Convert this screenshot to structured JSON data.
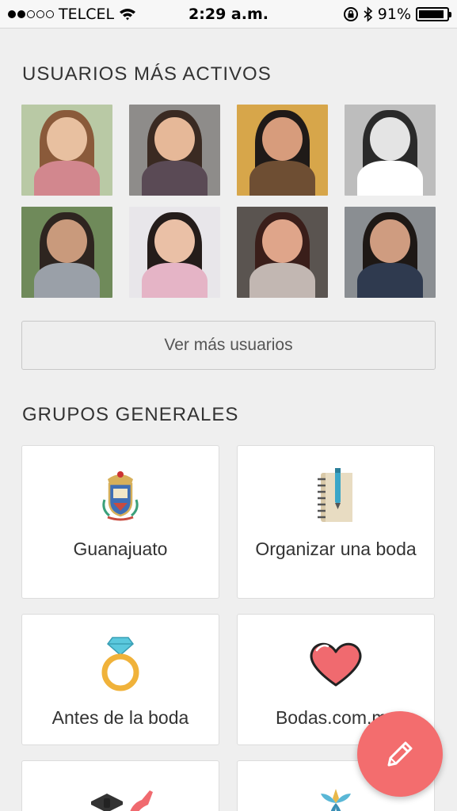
{
  "status_bar": {
    "carrier": "TELCEL",
    "time": "2:29 a.m.",
    "battery": "91%",
    "battery_level": 0.91,
    "signal_bars_filled": 2,
    "signal_bars_total": 5
  },
  "active_users": {
    "title": "USUARIOS MÁS ACTIVOS",
    "more_button": "Ver más usuarios",
    "avatars": [
      {
        "bg": "#b9c9a5",
        "hair": "#8a5a3a",
        "skin": "#e8c0a0",
        "body": "#d2878e"
      },
      {
        "bg": "#8e8c8a",
        "hair": "#3a2a22",
        "skin": "#e6b898",
        "body": "#5a4a55"
      },
      {
        "bg": "#d7a64a",
        "hair": "#1f1a18",
        "skin": "#d79c7c",
        "body": "#6e4e33"
      },
      {
        "bg": "#bdbdbd",
        "hair": "#2a2a2a",
        "skin": "#e4e4e4",
        "body": "#ffffff"
      },
      {
        "bg": "#6f8a5a",
        "hair": "#2e2520",
        "skin": "#c99a7c",
        "body": "#9aa0a8"
      },
      {
        "bg": "#e8e6ea",
        "hair": "#241c1a",
        "skin": "#eac0a6",
        "body": "#e5b4c6"
      },
      {
        "bg": "#5a5450",
        "hair": "#3a1e1a",
        "skin": "#dfa58a",
        "body": "#c2b7b2"
      },
      {
        "bg": "#8a8e92",
        "hair": "#1e1815",
        "skin": "#cf9c80",
        "body": "#2f3a4f"
      }
    ]
  },
  "general_groups": {
    "title": "GRUPOS GENERALES",
    "cards": [
      {
        "label": "Guanajuato",
        "icon": "coat-of-arms-icon"
      },
      {
        "label": "Organizar una boda",
        "icon": "notebook-icon"
      },
      {
        "label": "Antes de la boda",
        "icon": "ring-icon"
      },
      {
        "label": "Bodas.com.mx",
        "icon": "heart-icon"
      },
      {
        "label": "",
        "icon": "bowtie-shoe-icon"
      },
      {
        "label": "",
        "icon": "flower-icon"
      }
    ]
  },
  "fab": {
    "icon": "pencil-icon",
    "color": "#f36d6e"
  }
}
